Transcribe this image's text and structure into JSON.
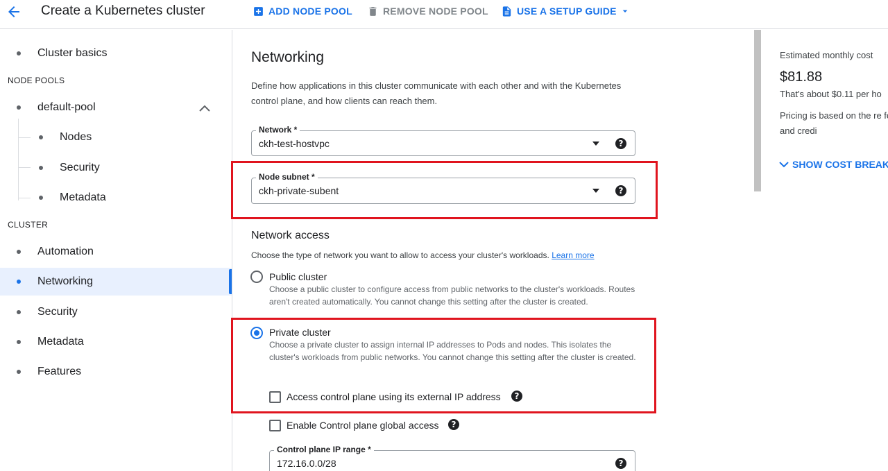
{
  "header": {
    "title": "Create a Kubernetes cluster",
    "add_node_pool": "ADD NODE POOL",
    "remove_node_pool": "REMOVE NODE POOL",
    "setup_guide": "USE A SETUP GUIDE"
  },
  "nav": {
    "cluster_basics": "Cluster basics",
    "node_pools_header": "NODE POOLS",
    "default_pool": "default-pool",
    "nodes": "Nodes",
    "pool_security": "Security",
    "pool_metadata": "Metadata",
    "cluster_header": "CLUSTER",
    "automation": "Automation",
    "networking": "Networking",
    "security": "Security",
    "metadata": "Metadata",
    "features": "Features",
    "active_item": "Networking"
  },
  "main": {
    "heading": "Networking",
    "description": "Define how applications in this cluster communicate with each other and with the Kubernetes control plane, and how clients can reach them.",
    "network": {
      "label": "Network *",
      "value": "ckh-test-hostvpc"
    },
    "node_subnet": {
      "label": "Node subnet *",
      "value": "ckh-private-subent"
    },
    "network_access": {
      "heading": "Network access",
      "description": "Choose the type of network you want to allow to access your cluster's workloads.",
      "learn_more": "Learn more",
      "public": {
        "title": "Public cluster",
        "description": "Choose a public cluster to configure access from public networks to the cluster's workloads. Routes aren't created automatically. You cannot change this setting after the cluster is created.",
        "selected": false
      },
      "private": {
        "title": "Private cluster",
        "description": "Choose a private cluster to assign internal IP addresses to Pods and nodes. This isolates the cluster's workloads from public networks. You cannot change this setting after the cluster is created.",
        "selected": true
      },
      "external_ip_checkbox": {
        "label": "Access control plane using its external IP address",
        "checked": false
      },
      "global_access_checkbox": {
        "label": "Enable Control plane global access",
        "checked": false
      },
      "control_plane_ip_range": {
        "label": "Control plane IP range *",
        "value": "172.16.0.0/28"
      }
    }
  },
  "cost": {
    "label": "Estimated monthly cost",
    "amount": "$81.88",
    "per_hour": "That's about $0.11 per ho",
    "pricing_note": "Pricing is based on the re fees, discounts and credi",
    "show_breakdown": "SHOW COST BREAKD"
  },
  "colors": {
    "accent": "#1a73e8",
    "highlight_box": "#e0141e",
    "active_nav_bg": "#e8f0fe"
  }
}
